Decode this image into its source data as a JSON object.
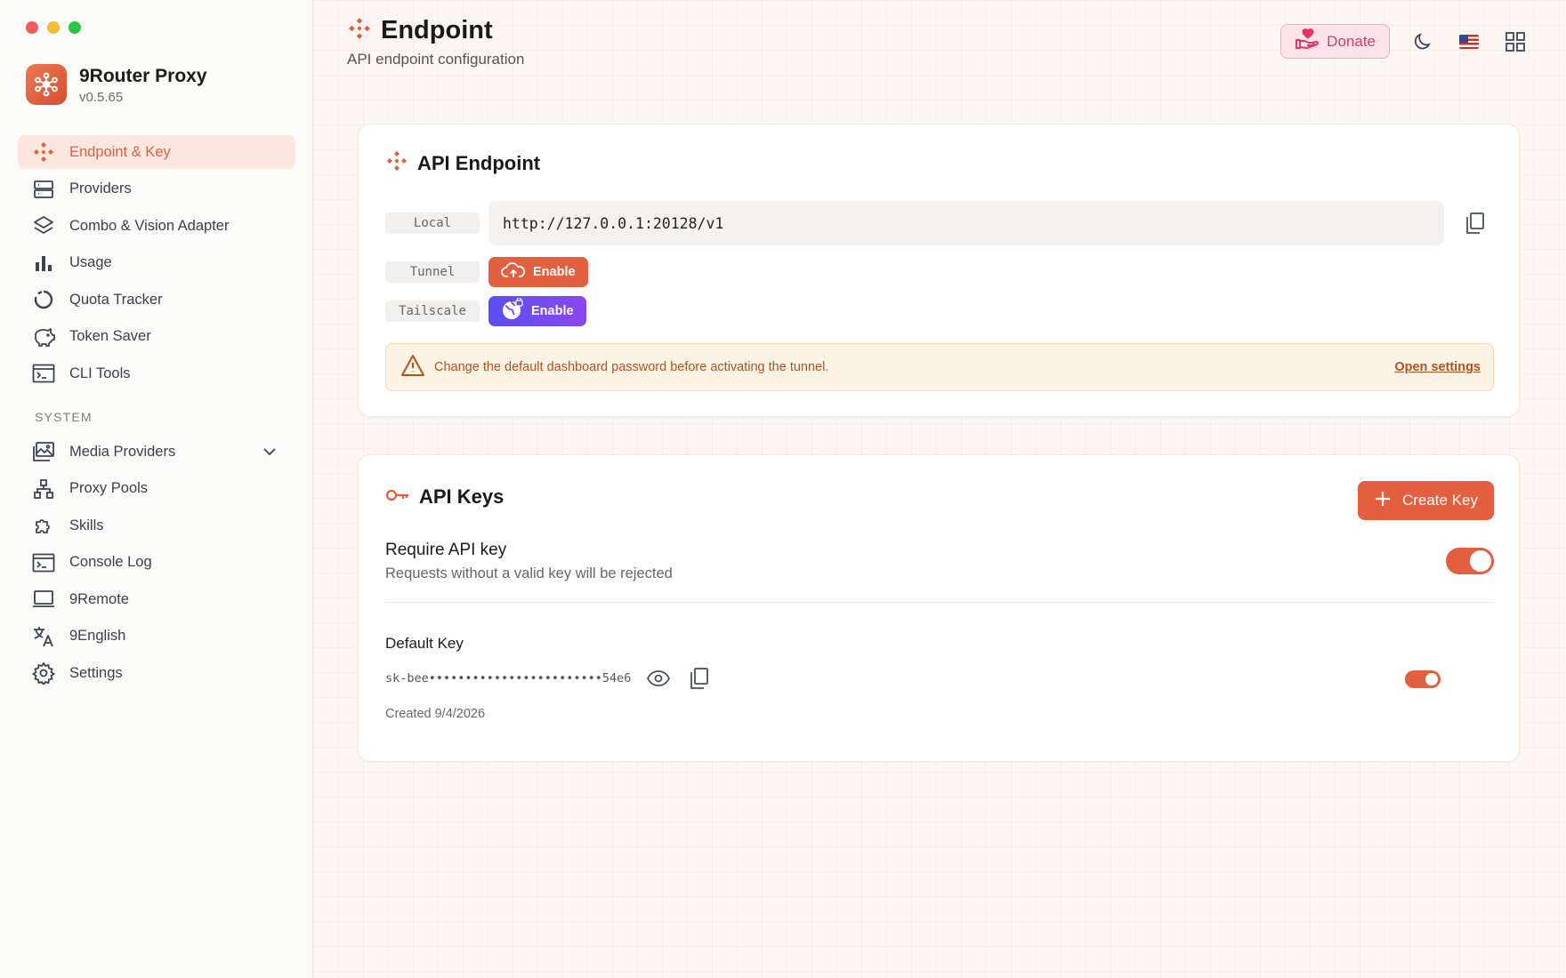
{
  "app": {
    "name": "9Router Proxy",
    "version": "v0.5.65"
  },
  "sidebar": {
    "items": [
      {
        "label": "Endpoint & Key",
        "icon": "endpoint-icon",
        "active": true
      },
      {
        "label": "Providers",
        "icon": "server-icon"
      },
      {
        "label": "Combo & Vision Adapter",
        "icon": "layers-icon"
      },
      {
        "label": "Usage",
        "icon": "bar-chart-icon"
      },
      {
        "label": "Quota Tracker",
        "icon": "circle-progress-icon"
      },
      {
        "label": "Token Saver",
        "icon": "piggy-bank-icon"
      },
      {
        "label": "CLI Tools",
        "icon": "terminal-icon"
      }
    ],
    "section_label": "SYSTEM",
    "system_items": [
      {
        "label": "Media Providers",
        "icon": "media-icon"
      },
      {
        "label": "Proxy Pools",
        "icon": "network-icon"
      },
      {
        "label": "Skills",
        "icon": "puzzle-icon"
      },
      {
        "label": "Console Log",
        "icon": "console-icon"
      },
      {
        "label": "9Remote",
        "icon": "laptop-icon"
      },
      {
        "label": "9English",
        "icon": "translate-icon"
      },
      {
        "label": "Settings",
        "icon": "gear-icon"
      }
    ]
  },
  "header": {
    "title": "Endpoint",
    "subtitle": "API endpoint configuration",
    "donate_label": "Donate"
  },
  "endpoint_card": {
    "title": "API Endpoint",
    "local_tag": "Local",
    "local_url": "http://127.0.0.1:20128/v1",
    "tunnel_tag": "Tunnel",
    "tunnel_button": "Enable",
    "tailscale_tag": "Tailscale",
    "tailscale_button": "Enable",
    "warning_text": "Change the default dashboard password before activating the tunnel.",
    "warning_link": "Open settings"
  },
  "keys_card": {
    "title": "API Keys",
    "create_button": "Create Key",
    "require_title": "Require API key",
    "require_desc": "Requests without a valid key will be rejected",
    "key_name": "Default Key",
    "key_value": "sk-bee••••••••••••••••••••••••54e6",
    "key_created": "Created 9/4/2026"
  },
  "colors": {
    "accent": "#e2603f",
    "donate": "#e0356a",
    "tailscale": "#6a4cf0",
    "warning": "#b0521e"
  }
}
